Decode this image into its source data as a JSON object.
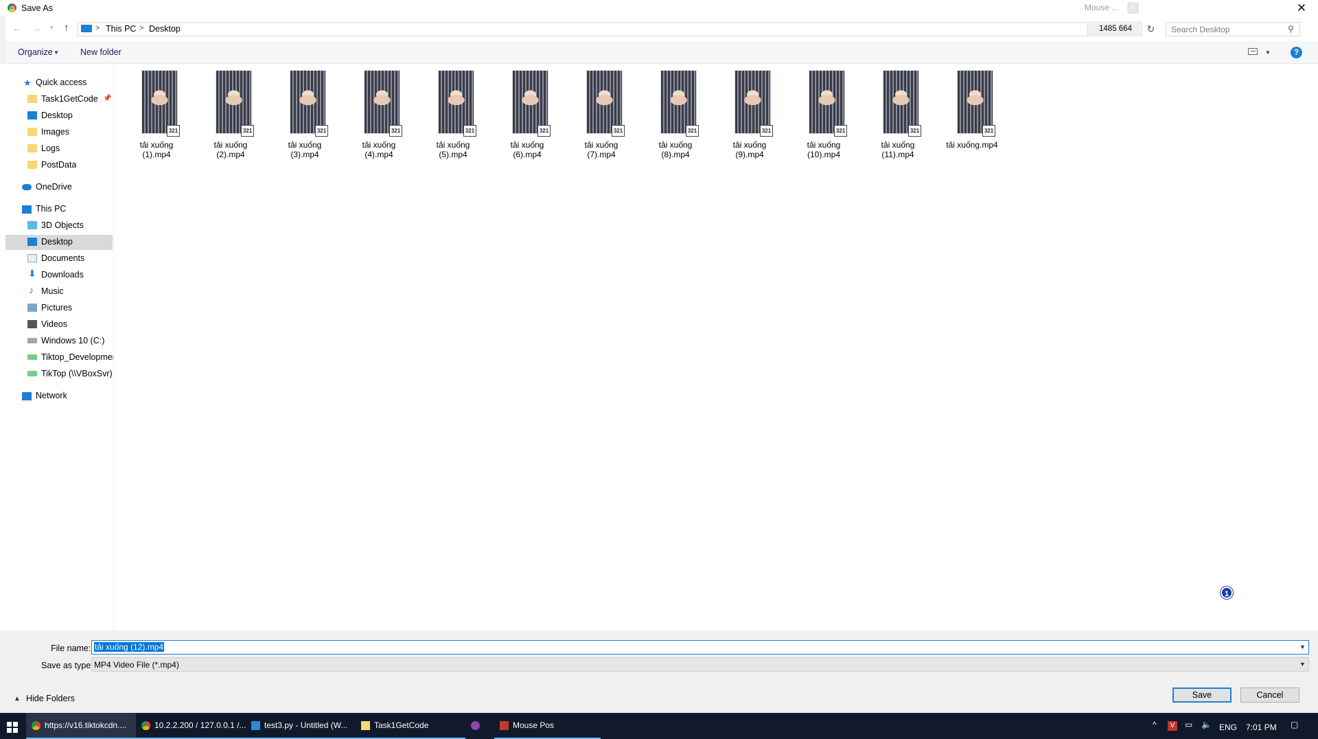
{
  "window": {
    "title": "Save As"
  },
  "mouse_pos_mini": {
    "title": "Mouse ...",
    "close": "x",
    "coords": "1485 664"
  },
  "address": {
    "segments": [
      "This PC",
      "Desktop"
    ],
    "separator": ">"
  },
  "search": {
    "placeholder": "Search Desktop"
  },
  "toolbar": {
    "organize": "Organize",
    "new_folder": "New folder",
    "help": "?"
  },
  "nav": {
    "quick_access": "Quick access",
    "quick_items": [
      "Task1GetCode",
      "Desktop",
      "Images",
      "Logs",
      "PostData"
    ],
    "onedrive": "OneDrive",
    "this_pc": "This PC",
    "pc_items": [
      "3D Objects",
      "Desktop",
      "Documents",
      "Downloads",
      "Music",
      "Pictures",
      "Videos",
      "Windows 10 (C:)",
      "Tiktop_Developmer",
      "TikTop (\\\\VBoxSvr)"
    ],
    "network": "Network",
    "selected": "Desktop"
  },
  "files": [
    {
      "line1": "tải xuống",
      "line2": "(1).mp4"
    },
    {
      "line1": "tải xuống",
      "line2": "(2).mp4"
    },
    {
      "line1": "tải xuống",
      "line2": "(3).mp4"
    },
    {
      "line1": "tải xuống",
      "line2": "(4).mp4"
    },
    {
      "line1": "tải xuống",
      "line2": "(5).mp4"
    },
    {
      "line1": "tải xuống",
      "line2": "(6).mp4"
    },
    {
      "line1": "tải xuống",
      "line2": "(7).mp4"
    },
    {
      "line1": "tải xuống",
      "line2": "(8).mp4"
    },
    {
      "line1": "tải xuống",
      "line2": "(9).mp4"
    },
    {
      "line1": "tải xuống",
      "line2": "(10).mp4"
    },
    {
      "line1": "tải xuống",
      "line2": "(11).mp4"
    },
    {
      "line1": "tải xuống.mp4",
      "line2": ""
    }
  ],
  "file_badge": "321",
  "notification_badge": "1",
  "form": {
    "file_name_label": "File name:",
    "file_name_value": "tải xuống (12).mp4",
    "save_type_label": "Save as type:",
    "save_type_value": "MP4 Video File (*.mp4)",
    "hide_folders": "Hide Folders",
    "save": "Save",
    "cancel": "Cancel"
  },
  "taskbar": {
    "items": [
      "https://v16.tiktokcdn....",
      "10.2.2.200 / 127.0.0.1 /...",
      "test3.py - Untitled (W...",
      "Task1GetCode",
      "",
      "Mouse Pos"
    ],
    "language": "ENG",
    "time": "7:01 PM"
  },
  "colors": {
    "accent": "#0078d7",
    "taskbar": "#101a2a",
    "selected_nav": "#d9d9d9",
    "dialog_bg": "#f0f0f0"
  }
}
